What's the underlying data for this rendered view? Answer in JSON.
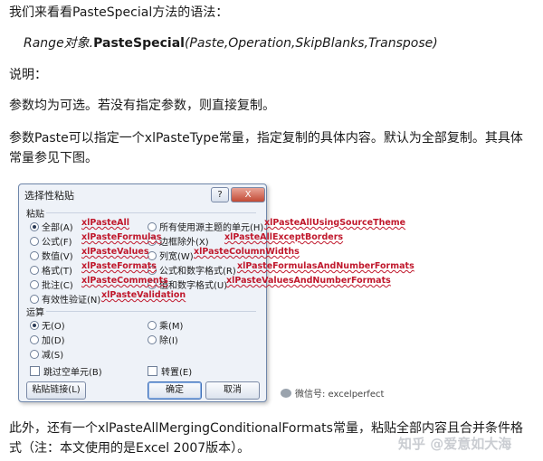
{
  "intro": "我们来看看PasteSpecial方法的语法：",
  "syntax": {
    "prefix": "Range对象.",
    "method": "PasteSpecial",
    "params": "(Paste,Operation,SkipBlanks,Transpose)"
  },
  "shuoming": "说明：",
  "para1": "参数均为可选。若没有指定参数，则直接复制。",
  "para2": "参数Paste可以指定一个xlPasteType常量，指定复制的具体内容。默认为全部复制。其具体常量参见下图。",
  "dialog": {
    "title": "选择性粘贴",
    "help": "?",
    "close": "X",
    "paste_group": "粘贴",
    "paste_left": [
      "全部(A)",
      "公式(F)",
      "数值(V)",
      "格式(T)",
      "批注(C)",
      "有效性验证(N)"
    ],
    "paste_right": [
      "所有使用源主题的单元(H)",
      "边框除外(X)",
      "列宽(W)",
      "公式和数字格式(R)",
      "值和数字格式(U)"
    ],
    "op_group": "运算",
    "op_left": [
      "无(O)",
      "加(D)",
      "减(S)"
    ],
    "op_right": [
      "乘(M)",
      "除(I)"
    ],
    "skip_blanks": "跳过空单元(B)",
    "transpose": "转置(E)",
    "paste_link": "粘贴链接(L)",
    "ok": "确定",
    "cancel": "取消"
  },
  "annotations": {
    "left": [
      "xlPasteAll",
      "xlPasteFormulas",
      "xlPasteValues",
      "xlPasteFormats",
      "xlPasteComments",
      "xlPasteValidation"
    ],
    "right": [
      "xlPasteAllUsingSourceTheme",
      "xlPasteAllExceptBorders",
      "xlPasteColumnWidths",
      "xlPasteFormulasAndNumberFormats",
      "xlPasteValuesAndNumberFormats"
    ]
  },
  "watermark_wechat": "微信号: excelperfect",
  "para_end": "此外，还有一个xlPasteAllMergingConditionalFormats常量，粘贴全部内容且合并条件格式（注：本文使用的是Excel 2007版本）。",
  "watermark_zhihu": "知乎 @爱意如大海"
}
